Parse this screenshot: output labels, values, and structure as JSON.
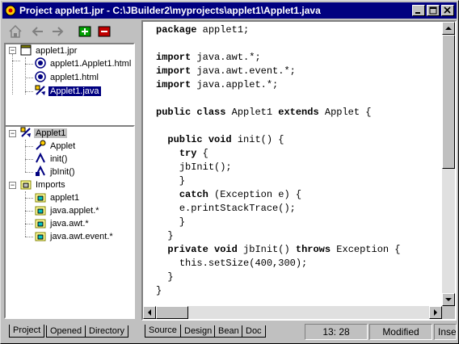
{
  "window": {
    "title": "Project applet1.jpr - C:\\JBuilder2\\myprojects\\applet1\\Applet1.java",
    "title_color": "#000080"
  },
  "toolbar": {
    "icons": [
      "home-icon",
      "back-arrow-icon",
      "forward-arrow-icon",
      "add-file-icon",
      "remove-file-icon"
    ]
  },
  "project_tree": {
    "root": "applet1.jpr",
    "children": [
      "applet1.Applet1.html",
      "applet1.html",
      "Applet1.java"
    ],
    "selected": "Applet1.java"
  },
  "structure_tree": {
    "class_node": "Applet1",
    "class_children": [
      "Applet",
      "init()",
      "jbInit()"
    ],
    "imports_node": "Imports",
    "imports_children": [
      "applet1",
      "java.applet.*",
      "java.awt.*",
      "java.awt.event.*"
    ]
  },
  "left_tabs": [
    "Project",
    "Opened",
    "Directory"
  ],
  "editor": {
    "lines": [
      "package applet1;",
      "",
      "import java.awt.*;",
      "import java.awt.event.*;",
      "import java.applet.*;",
      "",
      "public class Applet1 extends Applet {",
      "",
      "  public void init() {",
      "    try {",
      "    jbInit();",
      "    }",
      "    catch (Exception e) {",
      "    e.printStackTrace();",
      "    }",
      "  }",
      "  private void jbInit() throws Exception {",
      "    this.setSize(400,300);",
      "  }",
      "}"
    ]
  },
  "bottom_tabs": [
    "Source",
    "Design",
    "Bean",
    "Doc"
  ],
  "status": {
    "position": "13: 28",
    "modified": "Modified",
    "mode": "Insert"
  }
}
